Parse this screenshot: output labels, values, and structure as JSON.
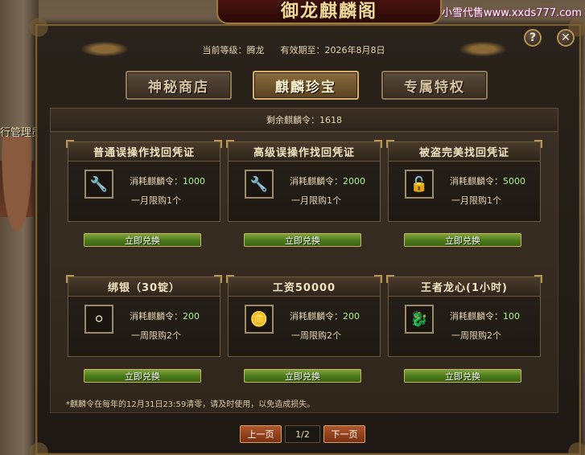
{
  "watermark": "小雪代售www.xxds777.com",
  "scene": {
    "npc_label": "行管理员"
  },
  "window": {
    "title": "御龙麒麟阁",
    "help_label": "?",
    "close_label": "✕"
  },
  "info": {
    "level_label": "当前等级：腾龙",
    "expire_label": "有效期至：2026年8月8日"
  },
  "tabs": [
    {
      "label": "神秘商店",
      "active": false
    },
    {
      "label": "麒麟珍宝",
      "active": true
    },
    {
      "label": "专属特权",
      "active": false
    }
  ],
  "remaining": "剩余麒麟令：1618",
  "items": [
    {
      "title": "普通误操作找回凭证",
      "cost_label": "消耗麒麟令：",
      "cost": "1000",
      "limit": "一月限购1个",
      "icon": "wrench-icon",
      "redeem": "立即兑换"
    },
    {
      "title": "高级误操作找回凭证",
      "cost_label": "消耗麒麟令：",
      "cost": "2000",
      "limit": "一月限购1个",
      "icon": "wrench-icon",
      "redeem": "立即兑换"
    },
    {
      "title": "被盗完美找回凭证",
      "cost_label": "消耗麒麟令：",
      "cost": "5000",
      "limit": "一月限购1个",
      "icon": "lock-icon",
      "redeem": "立即兑换"
    },
    {
      "title": "绑银（30锭）",
      "cost_label": "消耗麒麟令：",
      "cost": "200",
      "limit": "一周限购2个",
      "icon": "silver-ingot-icon",
      "redeem": "立即兑换"
    },
    {
      "title": "工资50000",
      "cost_label": "消耗麒麟令：",
      "cost": "200",
      "limit": "一周限购2个",
      "icon": "gold-coins-icon",
      "redeem": "立即兑换"
    },
    {
      "title": "王者龙心(1小时)",
      "cost_label": "消耗麒麟令：",
      "cost": "100",
      "limit": "一周限购2个",
      "icon": "dragon-heart-icon",
      "redeem": "立即兑换"
    }
  ],
  "note": "*麒麟令在每年的12月31日23:59清零，请及时使用，以免造成损失。",
  "pager": {
    "prev": "上一页",
    "page": "1/2",
    "next": "下一页"
  }
}
